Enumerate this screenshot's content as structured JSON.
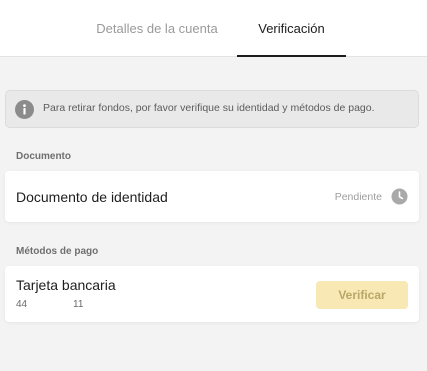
{
  "tabs": [
    {
      "label": "Detalles de la cuenta",
      "active": false
    },
    {
      "label": "Verificación",
      "active": true
    }
  ],
  "notice": {
    "icon": "info-icon",
    "text": "Para retirar fondos, por favor verifique su identidad y métodos de pago."
  },
  "document_section": {
    "label": "Documento",
    "item": {
      "title": "Documento de identidad",
      "status": "Pendiente",
      "status_icon": "clock-icon"
    }
  },
  "payment_section": {
    "label": "Métodos de pago",
    "item": {
      "title": "Tarjeta bancaria",
      "number_start": "44",
      "number_end": "11",
      "button_label": "Verificar"
    }
  },
  "colors": {
    "accent_button_bg": "#f8e9b4",
    "accent_button_text": "#b8a768",
    "active_tab": "#1c1c1c",
    "inactive_tab": "#9a9a9a"
  }
}
